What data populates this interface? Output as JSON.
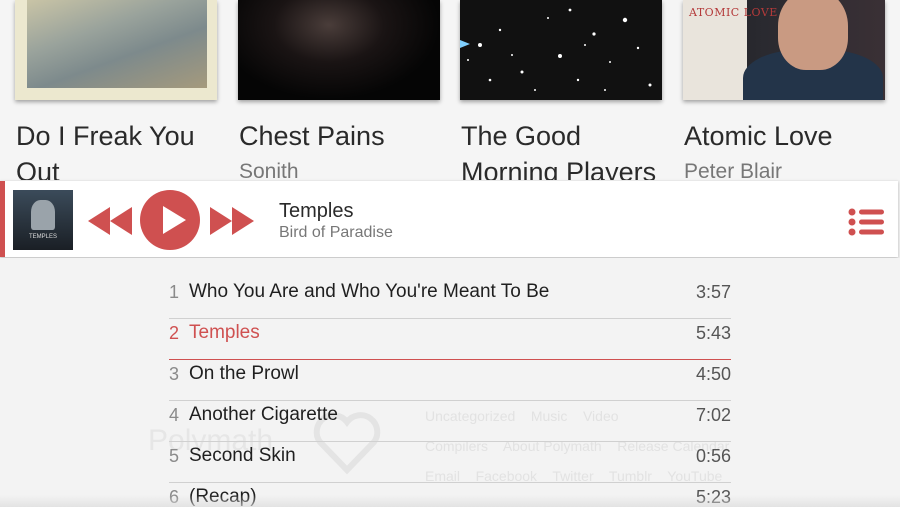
{
  "albums": [
    {
      "title_line1": "Do I Freak You",
      "title_line2": "Out"
    },
    {
      "title_line1": "Chest Pains",
      "artist": "Sonith"
    },
    {
      "title_line1": "The Good",
      "title_line2": "Morning Players"
    },
    {
      "title_line1": "Atomic Love",
      "artist": "Peter Blair",
      "cover_text": "ATOMIC LOVE"
    }
  ],
  "player": {
    "accent_color": "#cf5050",
    "thumb_caption": "TEMPLES",
    "track_title": "Temples",
    "track_artist": "Bird of Paradise",
    "icons": {
      "prev": "rewind-icon",
      "play": "play-icon",
      "next": "fast-forward-icon",
      "queue": "list-icon"
    }
  },
  "tracks": [
    {
      "num": "1",
      "name": "Who You Are and Who You're Meant To Be",
      "duration": "3:57"
    },
    {
      "num": "2",
      "name": "Temples",
      "duration": "5:43",
      "active": true
    },
    {
      "num": "3",
      "name": "On the Prowl",
      "duration": "4:50"
    },
    {
      "num": "4",
      "name": "Another Cigarette",
      "duration": "7:02"
    },
    {
      "num": "5",
      "name": "Second Skin",
      "duration": "0:56"
    },
    {
      "num": "6",
      "name": "(Recap)",
      "duration": "5:23"
    }
  ],
  "background_footer": {
    "logo": "Polymath",
    "links_row1": [
      "Uncategorized",
      "Music",
      "Video"
    ],
    "links_row2": [
      "Compilers",
      "About Polymath",
      "Release Calendar"
    ],
    "links_row3": [
      "Email",
      "Facebook",
      "Twitter",
      "Tumblr",
      "YouTube"
    ]
  }
}
